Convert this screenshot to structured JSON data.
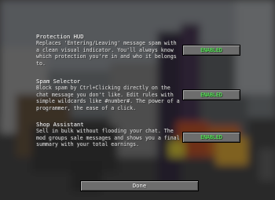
{
  "features": [
    {
      "title": "Protection HUD",
      "description": "Replaces 'Entering/Leaving' message spam with a clean visual indicator. You'll always know which protection you're in and who it belongs to.",
      "status": "ENABLED"
    },
    {
      "title": "Spam Selector",
      "description": "Block spam by Ctrl+Clicking directly on the chat message you don't like. Edit rules with simple wildcards like #number#. The power of a programmer, the ease of a click.",
      "status": "ENABLED"
    },
    {
      "title": "Shop Assistant",
      "description": "Sell in bulk without flooding your chat. The mod groups sale messages and shows you a final summary with your total earnings.",
      "status": "ENABLED"
    }
  ],
  "done_label": "Done",
  "colors": {
    "enabled_text": "#55ff55",
    "button_bg": "#6d6d6d",
    "title_text": "#ffffff",
    "description_text": "#e0e0e0"
  }
}
